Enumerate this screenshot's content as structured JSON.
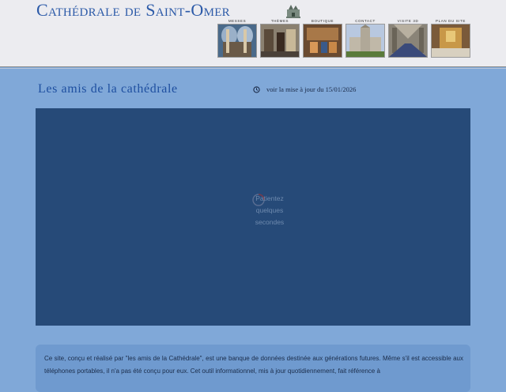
{
  "header": {
    "site_title": "Cathédrale de Saint-Omer",
    "nav": [
      {
        "label": "MESSES",
        "icon": "organ-pipes-photo"
      },
      {
        "label": "THÈMES",
        "icon": "chapel-altar-photo"
      },
      {
        "label": "BOUTIQUE",
        "icon": "interior-photo"
      },
      {
        "label": "CONTACT",
        "icon": "cathedral-exterior-photo"
      },
      {
        "label": "VISITE 3D",
        "icon": "nave-photo"
      },
      {
        "label": "PLAN DU SITE",
        "icon": "golden-altar-photo"
      }
    ]
  },
  "main": {
    "title": "Les amis de la cathédrale",
    "update_text": "voir la mise à jour du 15/01/2026",
    "loader_lines": [
      "Patientez",
      "quelques",
      "secondes"
    ]
  },
  "intro": {
    "text": "Ce site, conçu et réalisé par \"les amis de la Cathédrale\", est une banque de données destinée aux générations futures. Même s'il est accessible aux téléphones portables, il n'a pas été conçu pour eux. Cet outil informationnel, mis à jour quotidiennement, fait référence à"
  },
  "colors": {
    "page_bg": "#80a8d8",
    "header_bg": "#ececf0",
    "title_blue": "#2c5aa8",
    "viewer_bg": "#264a78",
    "intro_bg": "#6f9acf"
  }
}
